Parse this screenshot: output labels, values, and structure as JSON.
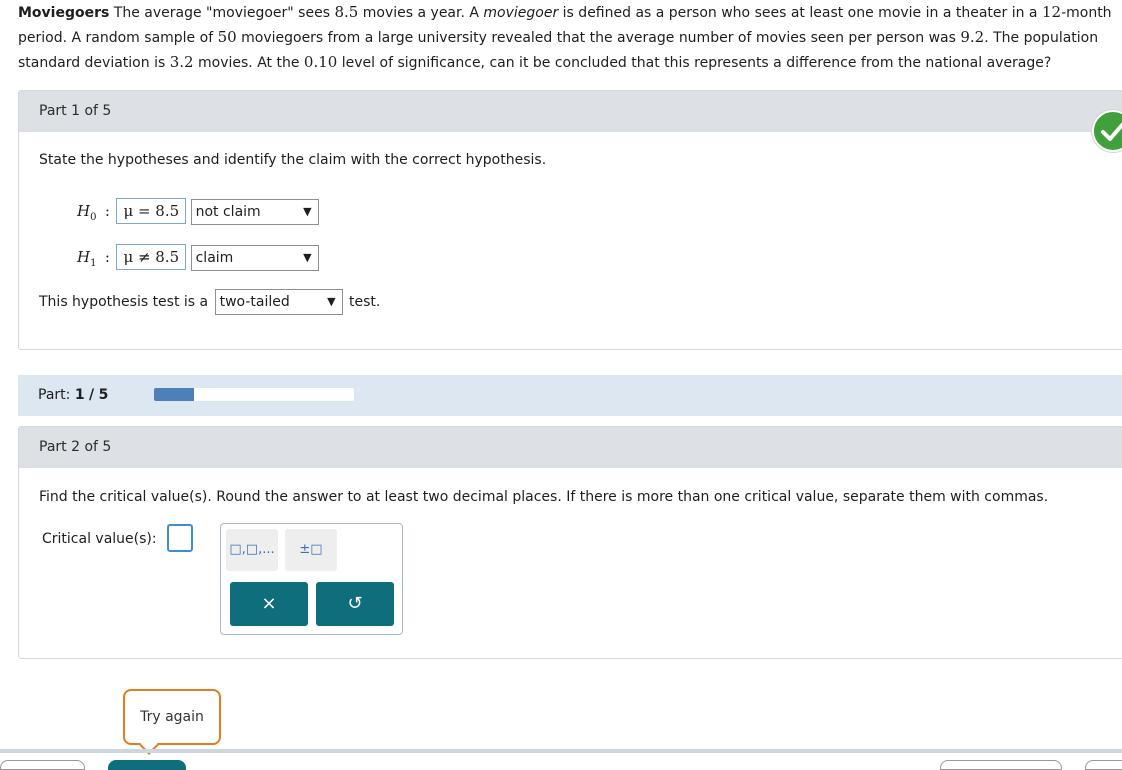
{
  "problem": {
    "title": "Moviegoers",
    "segments": [
      {
        "t": " The average \"moviegoer\" sees ",
        "k": "text"
      },
      {
        "t": "8.5",
        "k": "math"
      },
      {
        "t": " movies a year. A ",
        "k": "text"
      },
      {
        "t": "moviegoer",
        "k": "italic"
      },
      {
        "t": " is defined as a person who sees at least one movie in a theater in a ",
        "k": "text"
      },
      {
        "t": "12",
        "k": "math"
      },
      {
        "t": "-month period. A random sample of ",
        "k": "text"
      },
      {
        "t": "50",
        "k": "math"
      },
      {
        "t": " moviegoers from a large university revealed that the average number of movies seen per person was ",
        "k": "text"
      },
      {
        "t": "9.2",
        "k": "math"
      },
      {
        "t": ". The population standard deviation is ",
        "k": "text"
      },
      {
        "t": "3.2",
        "k": "math"
      },
      {
        "t": " movies. At the ",
        "k": "text"
      },
      {
        "t": "0.10",
        "k": "math"
      },
      {
        "t": " level of significance, can it be concluded that this represents a difference from the national average?",
        "k": "text"
      }
    ]
  },
  "part1": {
    "header": "Part 1 of 5",
    "instruction": "State the hypotheses and identify the claim with the correct hypothesis.",
    "h0": {
      "symbol": "H",
      "sub": "0",
      "colon": ":",
      "value": "μ = 8.5",
      "claim": "not claim"
    },
    "h1": {
      "symbol": "H",
      "sub": "1",
      "colon": ":",
      "value": "μ ≠ 8.5",
      "claim": "claim"
    },
    "test_prefix": "This hypothesis test is a",
    "test_type": "two-tailed",
    "test_suffix": "test.",
    "status": "correct"
  },
  "progress": {
    "label": "Part:",
    "current": "1",
    "separator": "/",
    "total": "5",
    "fraction": 0.2
  },
  "part2": {
    "header": "Part 2 of 5",
    "instruction": "Find the critical value(s). Round the answer to at least two decimal places. If there is more than one critical value, separate them with commas.",
    "critical_label": "Critical value(s):",
    "critical_value": "",
    "tools": {
      "list": "□,□,...",
      "plusminus": "±□"
    },
    "clear_icon": "×",
    "undo_icon": "↺"
  },
  "try_again": "Try again",
  "colors": {
    "header_bg": "#dde1e5",
    "progress_bg": "#dce7f1",
    "progress_fill": "#4e7fb8",
    "teal": "#0f6e7c",
    "check_green": "#3fa03c",
    "try_border": "#e27d1f"
  }
}
